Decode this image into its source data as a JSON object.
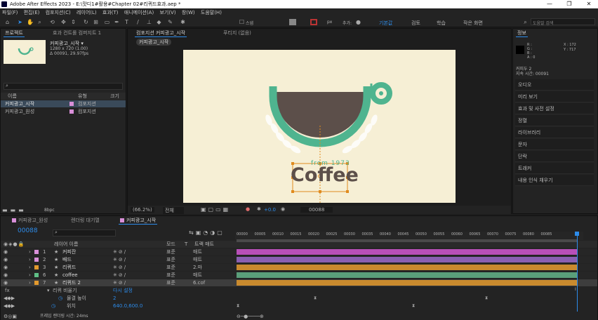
{
  "window": {
    "title": "Adobe After Effects 2023 - E:\\맛디1#활용#Chapter 02#리퀴드효과.aep *",
    "controls": [
      "—",
      "❐",
      "✕"
    ]
  },
  "menu": [
    "파일(F)",
    "편집(E)",
    "컴포지션(C)",
    "레이어(L)",
    "효과(T)",
    "애니메이션(A)",
    "보기(V)",
    "창(W)",
    "도움말(H)"
  ],
  "toolbar": {
    "snap_label": "스냅",
    "px_label": "px",
    "add_label": "추가:",
    "workspaces": [
      "기본값",
      "검토",
      "학습",
      "작은 화면"
    ],
    "search_placeholder": "도움말 검색"
  },
  "project_panel": {
    "tabs": [
      "프로젝트",
      "효과 컨트롤 컴퍼지트 1"
    ],
    "comp_name": "커피광고_시작 ▾",
    "comp_info1": "1280 x 720 (1.00)",
    "comp_info2": "Δ 00091, 29.97fps",
    "col_name": "이름",
    "col_type": "유형",
    "col_size": "크기",
    "items": [
      {
        "name": "커피광고_시작",
        "type": "컴포지션",
        "color": "#d98fd9"
      },
      {
        "name": "커피광고_원성",
        "type": "컴포지션",
        "color": "#d98fd9"
      }
    ],
    "bpc": "8bpc"
  },
  "comp_panel": {
    "tabs": [
      "컴포지션 커피광고_시작",
      "푸티지 (없음)"
    ],
    "crumb": "커피광고_시작",
    "zoom": "(66.2%)",
    "quality": "전체",
    "timecode": "00088",
    "plus": "+0.0",
    "coffee_text": "Coffee",
    "from_text": "from 1973"
  },
  "info_panel": {
    "title": "정보",
    "r": "R :",
    "g": "G :",
    "b": "B :",
    "a": "A : 0",
    "x": "X : 172",
    "y": "Y : 717",
    "layer": "커피두 2",
    "dur": "지속 시간: 00091",
    "items": [
      "오디오",
      "미리 보기",
      "효과 및 사전 설정",
      "정렬",
      "라이브러리",
      "문자",
      "단락",
      "트래커",
      "내용 인식 채우기"
    ]
  },
  "timeline": {
    "tabs": [
      "커피광고_원성",
      "렌더링 대기열",
      "커피광고_시작"
    ],
    "timecode": "00088",
    "col_source": "레이어 이름",
    "col_mode": "모드",
    "col_t": "T",
    "col_trkmat": "트랙 매트",
    "ruler": [
      "00000",
      "00005",
      "00010",
      "00015",
      "00020",
      "00025",
      "00030",
      "00035",
      "00040",
      "00045",
      "00050",
      "00055",
      "00060",
      "00065",
      "00070",
      "00075",
      "00080",
      "00085"
    ],
    "layers": [
      {
        "num": "1",
        "name": "커피잔",
        "color": "#d98fd9",
        "mode": "표준",
        "mat": "매트",
        "bar": "#b84fb8"
      },
      {
        "num": "2",
        "name": "배드",
        "color": "#d98fd9",
        "mode": "표준",
        "mat": "매트",
        "bar": "#8a5fb2"
      },
      {
        "num": "3",
        "name": "리퀴드",
        "color": "#e39a2e",
        "mode": "표준",
        "mat": "2.마",
        "bar": "#c98a2e"
      },
      {
        "num": "6",
        "name": "coffee",
        "color": "#5fbf86",
        "mode": "표준",
        "mat": "매트",
        "bar": "#5a9f7a"
      },
      {
        "num": "7",
        "name": "리퀴드 2",
        "color": "#e39a2e",
        "mode": "표준",
        "mat": "6.cof",
        "bar": "#c98a2e"
      }
    ],
    "fx": "리퀴 비율기",
    "fx_reset": "다시 설정",
    "prop1": "물결 높이",
    "prop1_val": "2",
    "prop2": "위치",
    "prop2_val": "640.0,600.0",
    "footer": "프레임 렌더링 시간: 24ms"
  },
  "colors": {
    "accent": "#2d8ceb",
    "bg": "#232323",
    "canvas": "#f6efd5",
    "teal": "#4fb48f",
    "brown": "#5c4f4a",
    "orange": "#e08b1e"
  }
}
